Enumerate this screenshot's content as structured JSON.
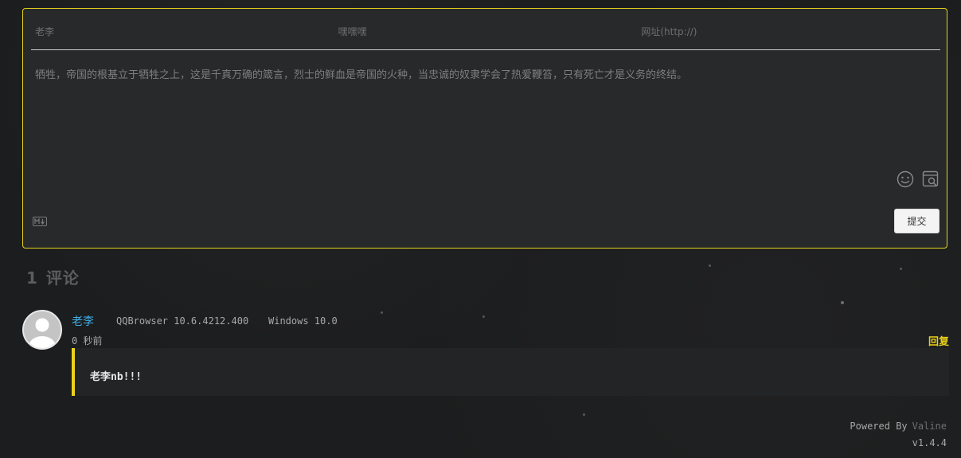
{
  "form": {
    "nick_placeholder": "老李",
    "mail_placeholder": "嘿嘿嘿",
    "link_placeholder": "网址(http://)",
    "comment_placeholder": "牺牲，帝国的根基立于牺牲之上，这是千真万确的箴言，烈士的鲜血是帝国的火种，当忠诚的奴隶学会了热爱鞭笞，只有死亡才是义务的终结。",
    "submit_label": "提交",
    "icons": [
      "emoji-icon",
      "preview-icon",
      "markdown-icon"
    ]
  },
  "count": {
    "number": "1",
    "label": "评论"
  },
  "comments": [
    {
      "nick": "老李",
      "browser": "QQBrowser 10.6.4212.400",
      "os": "Windows 10.0",
      "time": "0 秒前",
      "reply_label": "回复",
      "content": "老李nb!!!"
    }
  ],
  "footer": {
    "powered_by": "Powered By",
    "brand": "Valine",
    "version": "v1.4.4"
  },
  "colors": {
    "accent": "#e6d31c",
    "nick": "#3faee8",
    "background": "#1c1d1e"
  }
}
